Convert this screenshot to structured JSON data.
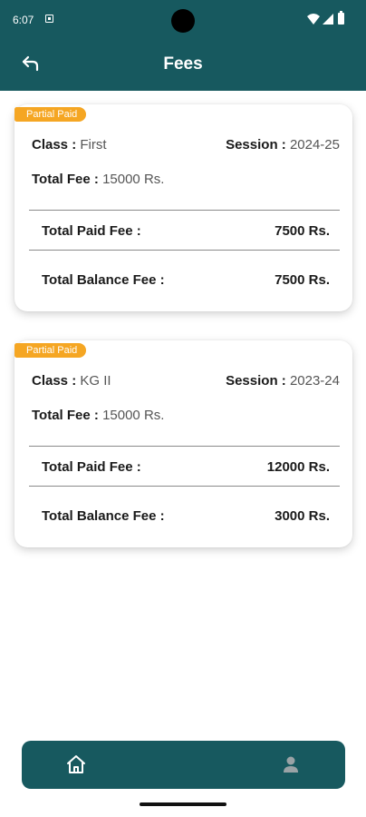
{
  "status_bar": {
    "time": "6:07"
  },
  "header": {
    "title": "Fees"
  },
  "fees": [
    {
      "badge": "Partial Paid",
      "class_label": "Class : ",
      "class_value": "First",
      "session_label": "Session : ",
      "session_value": "2024-25",
      "total_fee_label": "Total Fee : ",
      "total_fee_value": "15000 Rs.",
      "paid_label": "Total Paid Fee :",
      "paid_value": "7500 Rs.",
      "balance_label": "Total Balance Fee :",
      "balance_value": "7500 Rs."
    },
    {
      "badge": "Partial Paid",
      "class_label": "Class : ",
      "class_value": "KG II",
      "session_label": "Session : ",
      "session_value": "2023-24",
      "total_fee_label": "Total Fee : ",
      "total_fee_value": "15000 Rs.",
      "paid_label": "Total Paid Fee :",
      "paid_value": "12000 Rs.",
      "balance_label": "Total Balance Fee :",
      "balance_value": "3000 Rs."
    }
  ],
  "bottom_nav": {
    "items": [
      {
        "icon": "home-icon"
      },
      {
        "icon": "profile-icon"
      }
    ]
  },
  "colors": {
    "primary": "#17595f",
    "badge": "#f5a623",
    "inactive_icon": "#9aa3a6"
  }
}
